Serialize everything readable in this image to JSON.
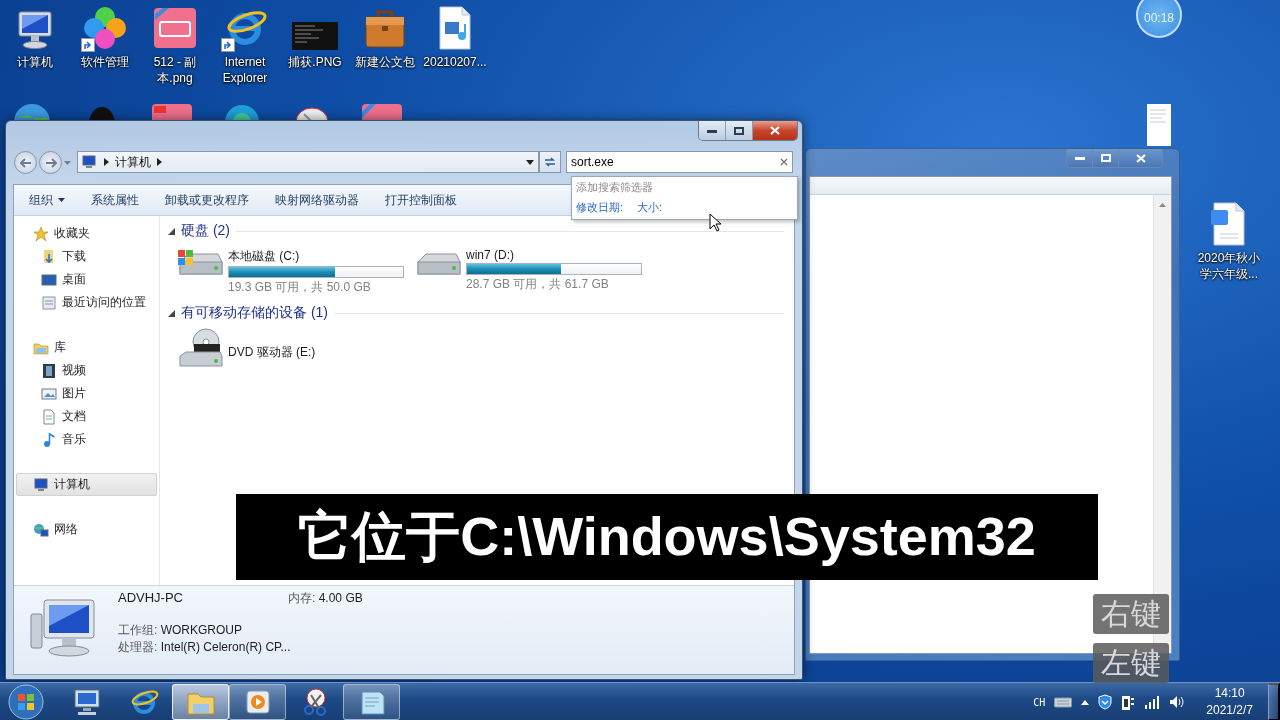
{
  "desktop_icons": [
    {
      "label": "计算机",
      "kind": "computer",
      "shortcut": false
    },
    {
      "label": "软件管理",
      "kind": "clover",
      "shortcut": true
    },
    {
      "label": "512 - 副本.png",
      "kind": "pink-image",
      "shortcut": false
    },
    {
      "label": "Internet Explorer",
      "kind": "ie",
      "shortcut": true
    },
    {
      "label": "捕获.PNG",
      "kind": "screenshot",
      "shortcut": false
    },
    {
      "label": "新建公文包",
      "kind": "briefcase",
      "shortcut": false
    },
    {
      "label": "20210207...",
      "kind": "media-file",
      "shortcut": false
    }
  ],
  "timer": {
    "text": "00:18"
  },
  "right_icons": [
    {
      "label": "2020年秋小学六年级...",
      "kind": "word-doc",
      "shortcut": false
    }
  ],
  "explorer": {
    "breadcrumb": [
      "计算机"
    ],
    "search": {
      "value": "sort.exe"
    },
    "search_dropdown": {
      "heading": "添加搜索筛选器",
      "filters": [
        "修改日期:",
        "大小:"
      ]
    },
    "toolbar": [
      {
        "label": "组织",
        "menu": true
      },
      {
        "label": "系统属性",
        "menu": false
      },
      {
        "label": "卸载或更改程序",
        "menu": false
      },
      {
        "label": "映射网络驱动器",
        "menu": false
      },
      {
        "label": "打开控制面板",
        "menu": false
      }
    ],
    "sidebar": [
      {
        "label": "收藏夹",
        "kind": "favorites",
        "selected": false,
        "children": [
          {
            "label": "下载",
            "kind": "downloads",
            "selected": false
          },
          {
            "label": "桌面",
            "kind": "desktop",
            "selected": false
          },
          {
            "label": "最近访问的位置",
            "kind": "recent",
            "selected": false
          }
        ]
      },
      {
        "label": "库",
        "kind": "libraries",
        "selected": false,
        "children": [
          {
            "label": "视频",
            "kind": "video",
            "selected": false
          },
          {
            "label": "图片",
            "kind": "pictures",
            "selected": false
          },
          {
            "label": "文档",
            "kind": "documents",
            "selected": false
          },
          {
            "label": "音乐",
            "kind": "music",
            "selected": false
          }
        ]
      },
      {
        "label": "计算机",
        "kind": "computer",
        "selected": true
      },
      {
        "label": "网络",
        "kind": "network",
        "selected": false
      }
    ],
    "sections": [
      {
        "title": "硬盘 (2)",
        "expanded": true,
        "drives": [
          {
            "name": "本地磁盘 (C:)",
            "kind": "system-disk",
            "level": 0.61,
            "space": "19.3 GB 可用，共 50.0 GB"
          },
          {
            "name": "win7 (D:)",
            "kind": "disk",
            "level": 0.54,
            "space": "28.7 GB 可用，共 61.7 GB"
          }
        ]
      },
      {
        "title": "有可移动存储的设备 (1)",
        "expanded": true,
        "drives": [
          {
            "name": "DVD 驱动器 (E:)",
            "kind": "dvd"
          }
        ]
      }
    ],
    "details": {
      "name": "ADVHJ-PC",
      "memory": {
        "label": "内存:",
        "value": "4.00 GB"
      },
      "workgroup": {
        "label": "工作组:",
        "value": "WORKGROUP"
      },
      "processor": {
        "label": "处理器:",
        "value": "Intel(R) Celeron(R) CP..."
      }
    }
  },
  "subtitle": "它位于C:\\Windows\\System32",
  "key_hints": [
    "右键",
    "左键"
  ],
  "taskbar": {
    "apps": [
      {
        "kind": "computer",
        "open": false,
        "selected": false
      },
      {
        "kind": "ie",
        "open": false,
        "selected": false
      },
      {
        "kind": "explorer",
        "open": true,
        "selected": true
      },
      {
        "kind": "media",
        "open": true,
        "selected": false
      },
      {
        "kind": "snipping",
        "open": false,
        "selected": false
      },
      {
        "kind": "notepad",
        "open": true,
        "selected": false
      }
    ],
    "language": "CH",
    "time": "14:10",
    "date": "2021/2/7"
  }
}
